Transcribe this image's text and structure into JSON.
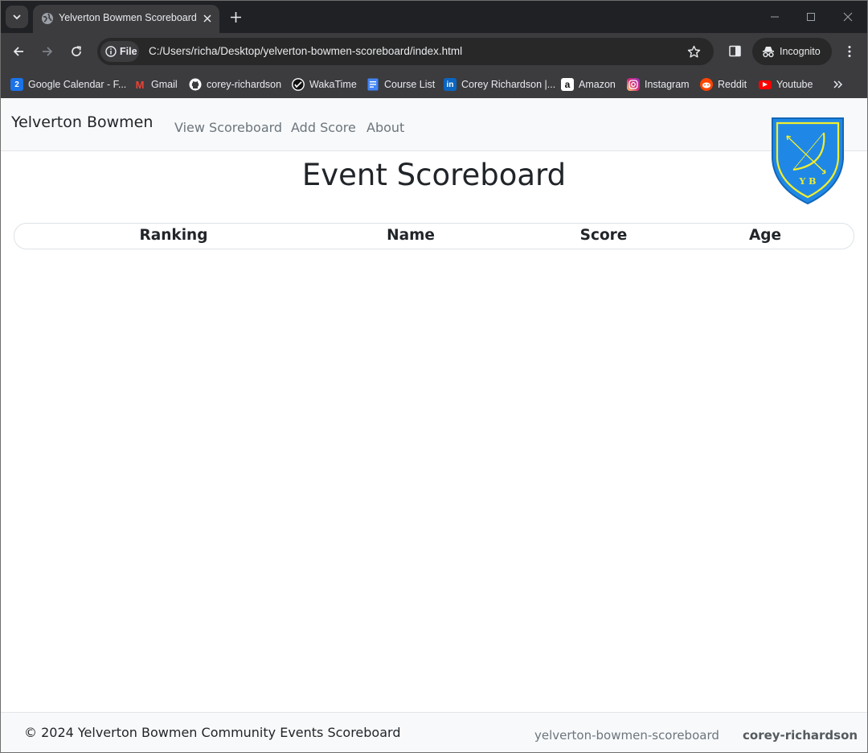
{
  "browser": {
    "tab_title": "Yelverton Bowmen Scoreboard",
    "file_chip": "File",
    "url": "C:/Users/richa/Desktop/yelverton-bowmen-scoreboard/index.html",
    "incognito": "Incognito",
    "icons": [
      "tab-search-icon",
      "globe-icon",
      "close-icon",
      "plus-icon",
      "minimize-icon",
      "maximize-icon",
      "window-close-icon",
      "back-icon",
      "forward-icon",
      "reload-icon",
      "info-icon",
      "star-icon",
      "side-panel-icon",
      "incognito-icon",
      "kebab-menu-icon",
      "chevron-double-right-icon"
    ]
  },
  "bookmarks": [
    {
      "label": "Google Calendar - F...",
      "icon": "google-calendar-icon",
      "icon_text": "2",
      "color": "#1a73e8"
    },
    {
      "label": "Gmail",
      "icon": "gmail-icon",
      "icon_text": "M",
      "color": "#ea4335"
    },
    {
      "label": "corey-richardson",
      "icon": "github-icon",
      "color": "#ffffff"
    },
    {
      "label": "WakaTime",
      "icon": "wakatime-icon",
      "color": "#ffffff"
    },
    {
      "label": "Course List",
      "icon": "document-icon",
      "color": "#4285f4"
    },
    {
      "label": "Corey Richardson |...",
      "icon": "linkedin-icon",
      "icon_text": "in",
      "color": "#0a66c2"
    },
    {
      "label": "Amazon",
      "icon": "amazon-icon",
      "icon_text": "a",
      "color": "#ffffff"
    },
    {
      "label": "Instagram",
      "icon": "instagram-icon",
      "color": "#d6249f"
    },
    {
      "label": "Reddit",
      "icon": "reddit-icon",
      "color": "#ff4500"
    },
    {
      "label": "Youtube",
      "icon": "youtube-icon",
      "color": "#ff0000"
    }
  ],
  "site": {
    "brand": "Yelverton Bowmen",
    "nav": [
      "View Scoreboard",
      "Add Score",
      "About"
    ],
    "logo_initials": "Y B",
    "logo_colors": {
      "shield": "#1f88e6",
      "trim": "#f2ee2e"
    },
    "page_title": "Event Scoreboard",
    "table_headers": [
      "Ranking",
      "Name",
      "Score",
      "Age"
    ],
    "footer": {
      "copyright": "© 2024 Yelverton Bowmen Community Events Scoreboard",
      "links": [
        "yelverton-bowmen-scoreboard",
        "corey-richardson"
      ]
    }
  }
}
